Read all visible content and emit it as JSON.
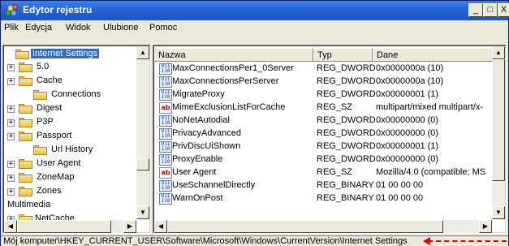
{
  "window": {
    "title": "Edytor rejestru",
    "min_label": "_",
    "max_label": "□",
    "close_label": "X"
  },
  "menu": [
    "Plik",
    "Edycja",
    "Widok",
    "Ulubione",
    "Pomoc"
  ],
  "tree": [
    {
      "label": "Internet Settings",
      "expander": "",
      "selected": true
    },
    {
      "label": "5.0",
      "expander": "+"
    },
    {
      "label": "Cache",
      "expander": "+"
    },
    {
      "label": "Connections",
      "expander": ""
    },
    {
      "label": "Digest",
      "expander": "+"
    },
    {
      "label": "P3P",
      "expander": "+"
    },
    {
      "label": "Passport",
      "expander": "+"
    },
    {
      "label": "Url History",
      "expander": ""
    },
    {
      "label": "User Agent",
      "expander": "+"
    },
    {
      "label": "ZoneMap",
      "expander": "+"
    },
    {
      "label": "Zones",
      "expander": "+"
    },
    {
      "label": "Multimedia",
      "expander": "+"
    },
    {
      "label": "NetCache",
      "expander": "+"
    }
  ],
  "columns": {
    "name": "Nazwa",
    "type": "Typ",
    "data": "Dane"
  },
  "values": [
    {
      "name": "MaxConnectionsPer1_0Server",
      "type": "REG_DWORD",
      "data": "0x0000000a (10)",
      "icon": "binary-value-icon"
    },
    {
      "name": "MaxConnectionsPerServer",
      "type": "REG_DWORD",
      "data": "0x0000000a (10)",
      "icon": "binary-value-icon"
    },
    {
      "name": "MigrateProxy",
      "type": "REG_DWORD",
      "data": "0x00000001 (1)",
      "icon": "binary-value-icon"
    },
    {
      "name": "MimeExclusionListForCache",
      "type": "REG_SZ",
      "data": "multipart/mixed multipart/x-",
      "icon": "string-value-icon"
    },
    {
      "name": "NoNetAutodial",
      "type": "REG_DWORD",
      "data": "0x00000000 (0)",
      "icon": "binary-value-icon"
    },
    {
      "name": "PrivacyAdvanced",
      "type": "REG_DWORD",
      "data": "0x00000000 (0)",
      "icon": "binary-value-icon"
    },
    {
      "name": "PrivDiscUiShown",
      "type": "REG_DWORD",
      "data": "0x00000001 (1)",
      "icon": "binary-value-icon"
    },
    {
      "name": "ProxyEnable",
      "type": "REG_DWORD",
      "data": "0x00000000 (0)",
      "icon": "binary-value-icon"
    },
    {
      "name": "User Agent",
      "type": "REG_SZ",
      "data": "Mozilla/4.0 (compatible; MS",
      "icon": "string-value-icon"
    },
    {
      "name": "UseSchannelDirectly",
      "type": "REG_BINARY",
      "data": "01 00 00 00",
      "icon": "binary-value-icon"
    },
    {
      "name": "WarnOnPost",
      "type": "REG_BINARY",
      "data": "01 00 00 00",
      "icon": "binary-value-icon"
    }
  ],
  "statusbar": {
    "path": "Mój komputer\\HKEY_CURRENT_USER\\Software\\Microsoft\\Windows\\CurrentVersion\\Internet Settings"
  },
  "colors": {
    "titlebar": "#2563d6",
    "selection": "#316ac5",
    "annotation_arrow": "#e60000"
  }
}
